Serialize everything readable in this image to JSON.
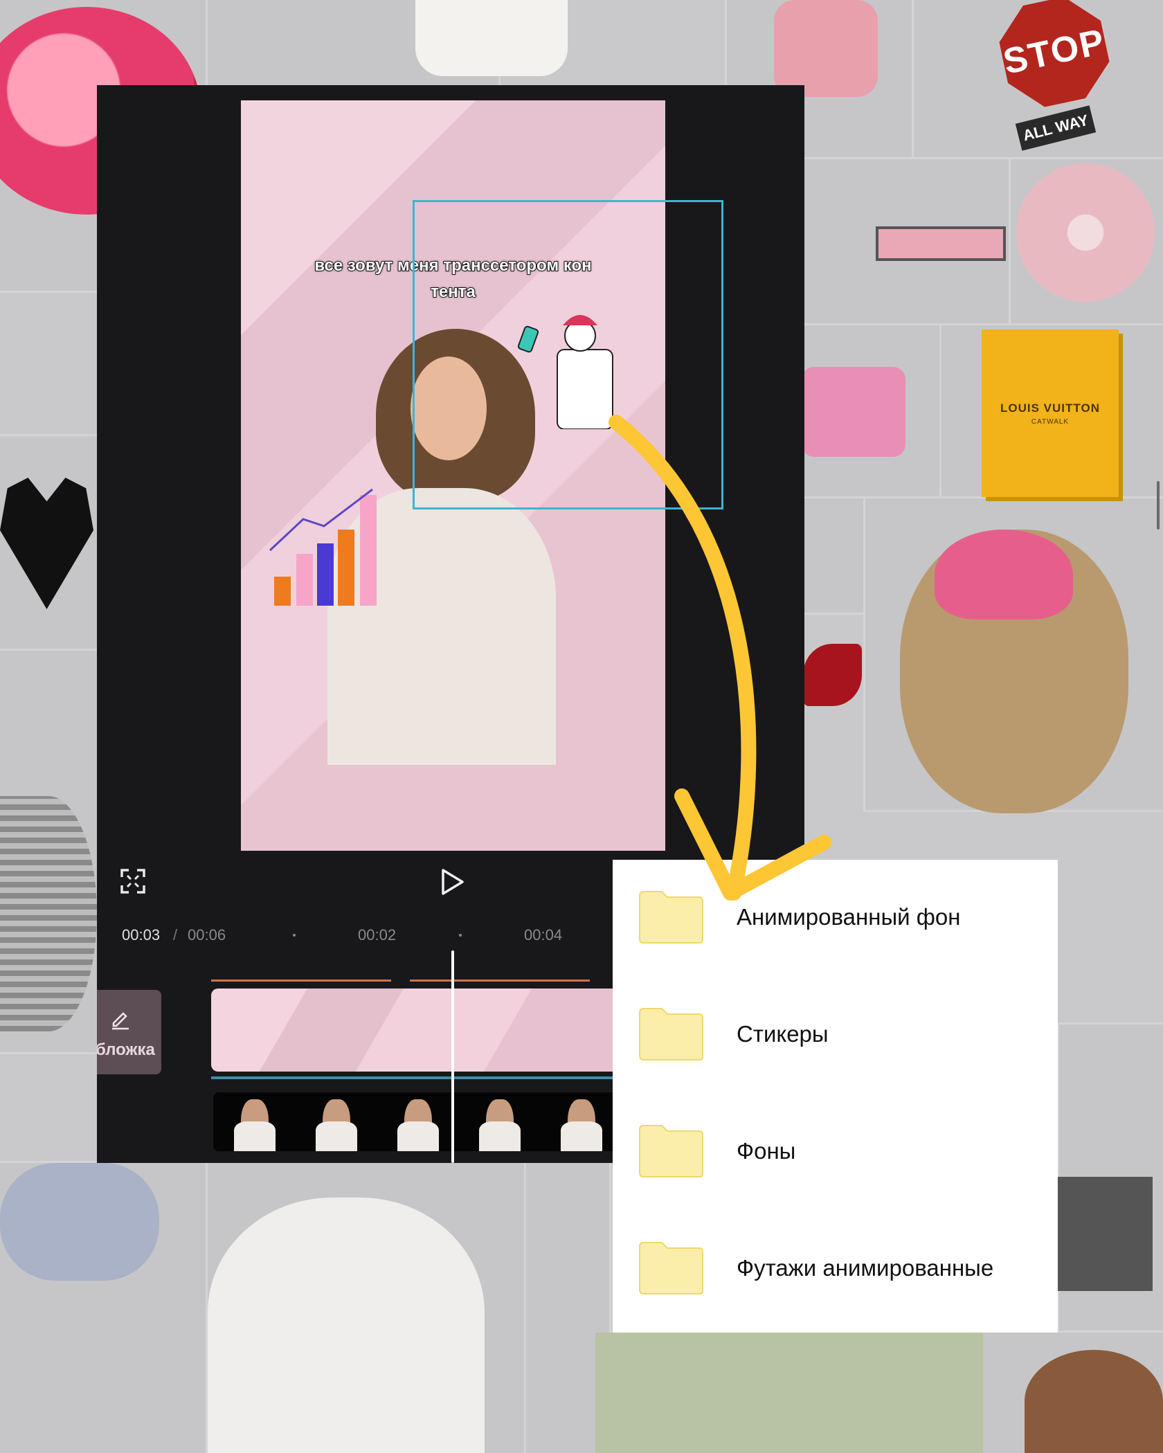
{
  "background": {
    "stickers": {
      "stop_sign": "STOP",
      "all_way": "ALL WAY",
      "book_title": "LOUIS VUITTON",
      "book_subtitle": "CATWALK"
    }
  },
  "editor": {
    "caption_line1": "все зовут меня трансcетором кон",
    "caption_line2": "тента",
    "time_current": "00:03",
    "time_separator": "/",
    "time_total": "00:06",
    "tick_1": "00:02",
    "tick_2": "00:04",
    "cover_label": "бложка",
    "icons": {
      "fullscreen": "fullscreen-icon",
      "play": "play-icon",
      "cover_edit": "pencil-icon"
    }
  },
  "folders": {
    "items": [
      {
        "label": "Анимированный фон"
      },
      {
        "label": "Стикеры"
      },
      {
        "label": "Фоны"
      },
      {
        "label": "Футажи анимированные"
      }
    ],
    "folder_color": "#fbeeaa"
  },
  "colors": {
    "arrow": "#fcc635",
    "selection": "#3bb6d4",
    "editor_bg": "#18181b",
    "preview_bg": "#efcad8"
  }
}
